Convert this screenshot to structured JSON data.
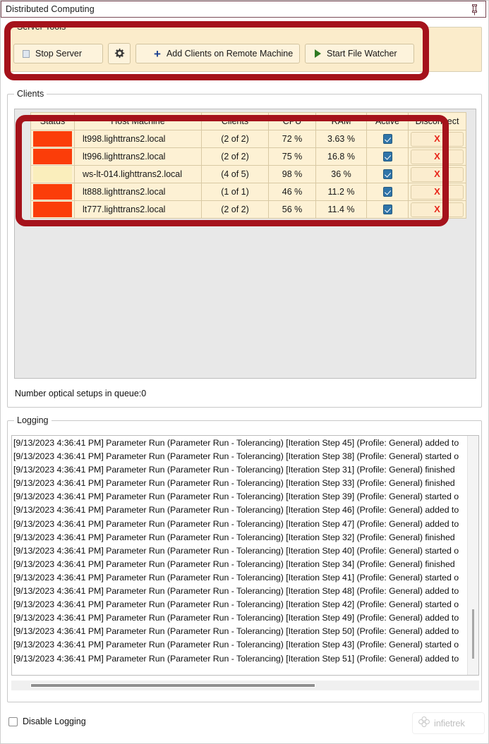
{
  "window": {
    "title": "Distributed Computing",
    "pin_icon": "pin-icon"
  },
  "server_tools": {
    "legend": "Server Tools",
    "buttons": [
      {
        "label": "Stop Server",
        "icon": "stop-square-icon"
      },
      {
        "label": "",
        "icon": "gear-icon"
      },
      {
        "label": "Add Clients on Remote Machine",
        "icon": "plus-icon"
      },
      {
        "label": "Start File Watcher",
        "icon": "play-triangle-icon"
      }
    ]
  },
  "clients": {
    "legend": "Clients",
    "columns": [
      "Status",
      "Host Machine",
      "Clients",
      "CPU",
      "RAM",
      "Active",
      "Disconnect"
    ],
    "rows": [
      {
        "status_color": "#fb3d09",
        "host": "lt998.lighttrans2.local",
        "clients": "(2 of 2)",
        "cpu": "72 %",
        "ram": "3.63 %",
        "active": true,
        "disconnect": "X"
      },
      {
        "status_color": "#fb3d09",
        "host": "lt996.lighttrans2.local",
        "clients": "(2 of 2)",
        "cpu": "75 %",
        "ram": "16.8 %",
        "active": true,
        "disconnect": "X"
      },
      {
        "status_color": "#faeebc",
        "host": "ws-lt-014.lighttrans2.local",
        "clients": "(4 of 5)",
        "cpu": "98 %",
        "ram": "36 %",
        "active": true,
        "disconnect": "X"
      },
      {
        "status_color": "#fb3d09",
        "host": "lt888.lighttrans2.local",
        "clients": "(1 of 1)",
        "cpu": "46 %",
        "ram": "11.2 %",
        "active": true,
        "disconnect": "X"
      },
      {
        "status_color": "#fb3d09",
        "host": "lt777.lighttrans2.local",
        "clients": "(2 of 2)",
        "cpu": "56 %",
        "ram": "11.4 %",
        "active": true,
        "disconnect": "X"
      }
    ],
    "queue_label": "Number optical setups in queue:0"
  },
  "logging": {
    "legend": "Logging",
    "lines": [
      "[9/13/2023 4:36:41 PM] Parameter Run (Parameter Run - Tolerancing) [Iteration Step 45] (Profile: General) added to",
      "[9/13/2023 4:36:41 PM] Parameter Run (Parameter Run - Tolerancing) [Iteration Step 38] (Profile: General) started o",
      "[9/13/2023 4:36:41 PM] Parameter Run (Parameter Run - Tolerancing) [Iteration Step 31] (Profile: General) finished",
      "[9/13/2023 4:36:41 PM] Parameter Run (Parameter Run - Tolerancing) [Iteration Step 33] (Profile: General) finished",
      "[9/13/2023 4:36:41 PM] Parameter Run (Parameter Run - Tolerancing) [Iteration Step 39] (Profile: General) started o",
      "[9/13/2023 4:36:41 PM] Parameter Run (Parameter Run - Tolerancing) [Iteration Step 46] (Profile: General) added to",
      "[9/13/2023 4:36:41 PM] Parameter Run (Parameter Run - Tolerancing) [Iteration Step 47] (Profile: General) added to",
      "[9/13/2023 4:36:41 PM] Parameter Run (Parameter Run - Tolerancing) [Iteration Step 32] (Profile: General) finished",
      "[9/13/2023 4:36:41 PM] Parameter Run (Parameter Run - Tolerancing) [Iteration Step 40] (Profile: General) started o",
      "[9/13/2023 4:36:41 PM] Parameter Run (Parameter Run - Tolerancing) [Iteration Step 34] (Profile: General) finished",
      "[9/13/2023 4:36:41 PM] Parameter Run (Parameter Run - Tolerancing) [Iteration Step 41] (Profile: General) started o",
      "[9/13/2023 4:36:41 PM] Parameter Run (Parameter Run - Tolerancing) [Iteration Step 48] (Profile: General) added to",
      "[9/13/2023 4:36:41 PM] Parameter Run (Parameter Run - Tolerancing) [Iteration Step 42] (Profile: General) started o",
      "[9/13/2023 4:36:41 PM] Parameter Run (Parameter Run - Tolerancing) [Iteration Step 49] (Profile: General) added to",
      "[9/13/2023 4:36:41 PM] Parameter Run (Parameter Run - Tolerancing) [Iteration Step 50] (Profile: General) added to",
      "[9/13/2023 4:36:41 PM] Parameter Run (Parameter Run - Tolerancing) [Iteration Step 43] (Profile: General) started o",
      "[9/13/2023 4:36:41 PM] Parameter Run (Parameter Run - Tolerancing) [Iteration Step 51] (Profile: General) added to"
    ]
  },
  "footer": {
    "disable_logging_label": "Disable Logging",
    "disable_logging_checked": false,
    "watermark_text": "infietrek"
  },
  "colors": {
    "annotation_red": "#a5121b",
    "panel_cream": "#fbeccb",
    "status_red": "#fb3d09",
    "status_cream": "#faeebc",
    "checkbox_blue": "#2f74a8",
    "disconnect_red": "#e8261a"
  }
}
